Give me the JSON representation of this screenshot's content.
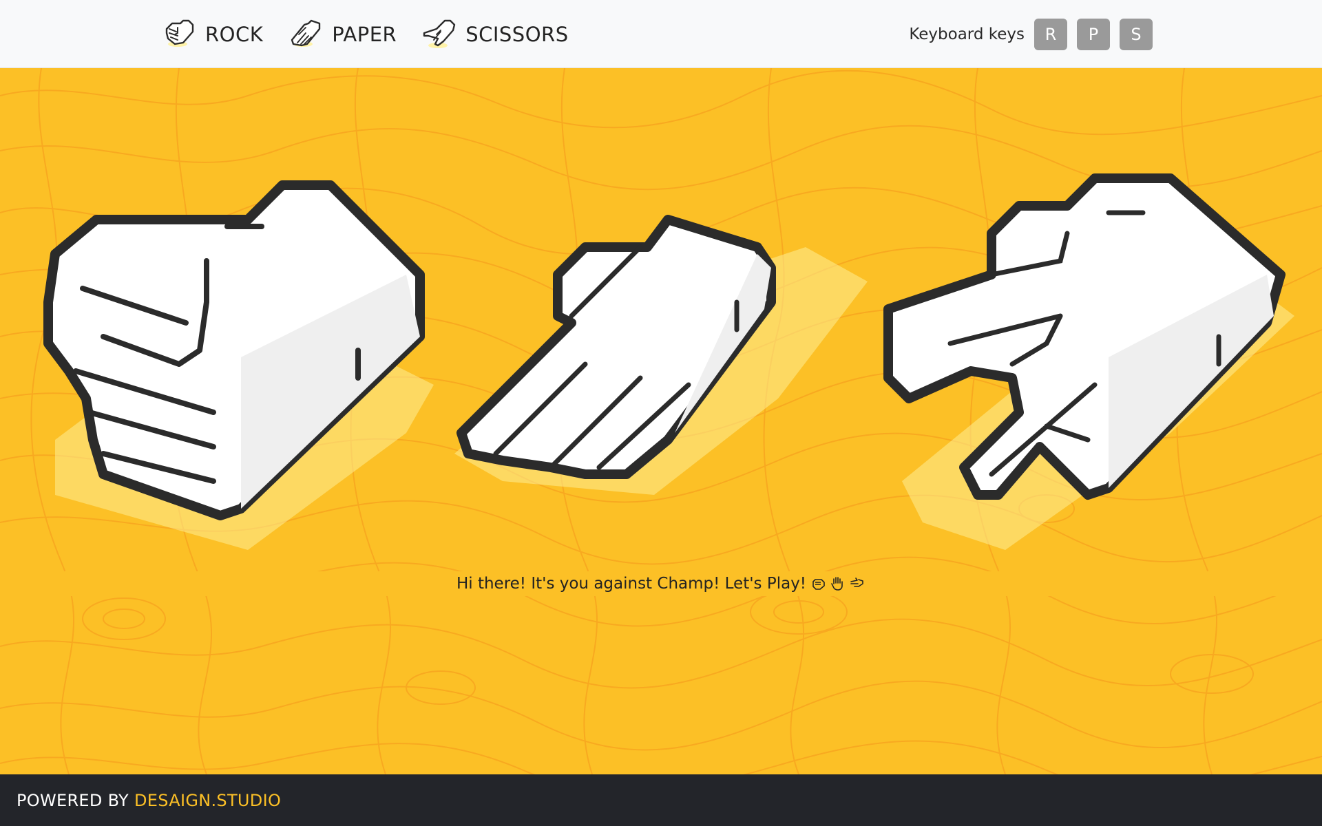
{
  "nav": {
    "items": [
      {
        "label": "ROCK",
        "icon": "rock-hand-icon"
      },
      {
        "label": "PAPER",
        "icon": "paper-hand-icon"
      },
      {
        "label": "SCISSORS",
        "icon": "scissors-hand-icon"
      }
    ]
  },
  "keys": {
    "label": "Keyboard keys",
    "items": [
      "R",
      "P",
      "S"
    ]
  },
  "play": {
    "hands": [
      {
        "name": "rock",
        "icon": "rock-hand-icon"
      },
      {
        "name": "paper",
        "icon": "paper-hand-icon"
      },
      {
        "name": "scissors",
        "icon": "scissors-hand-icon"
      }
    ],
    "message": "Hi there! It's you against Champ! Let's Play!",
    "message_icons": [
      "fist-emoji-icon",
      "raised-hand-emoji-icon",
      "victory-hand-emoji-icon"
    ]
  },
  "footer": {
    "prefix": "POWERED BY",
    "brand": "DESAIGN.STUDIO"
  },
  "colors": {
    "background": "#fcc026",
    "contour": "#f7a21e",
    "header": "#f8f9fa",
    "footer": "#23252a",
    "brand": "#fcc026",
    "key": "#9a9a9a",
    "outline": "#2b2b2b"
  }
}
